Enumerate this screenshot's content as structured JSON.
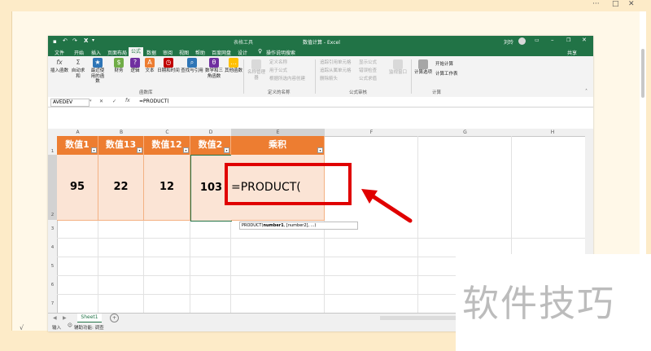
{
  "viewer": {
    "controls": [
      "···",
      "□",
      "✕"
    ],
    "tick": "√"
  },
  "window": {
    "tool_context": "表格工具",
    "title": "数值计算 - Excel",
    "user": "刘玲",
    "share": "共享",
    "qat_icons": [
      "save-icon",
      "undo-icon",
      "redo-icon",
      "excel-icon"
    ]
  },
  "ribbon_tabs": [
    "文件",
    "开始",
    "插入",
    "页面布局",
    "公式",
    "数据",
    "审阅",
    "视图",
    "帮助",
    "百度网盘",
    "设计"
  ],
  "active_tab": "公式",
  "tell_me": "操作说明搜索",
  "function_library": {
    "group_label": "函数库",
    "buttons": [
      {
        "label": "插入函数",
        "icon": "fx",
        "color": "#555"
      },
      {
        "label": "自动求和",
        "icon": "Σ",
        "color": "#555"
      },
      {
        "label": "最近使用的函数",
        "icon": "★",
        "color": "#2e75b6"
      },
      {
        "label": "财务",
        "icon": "$",
        "color": "#70ad47"
      },
      {
        "label": "逻辑",
        "icon": "?",
        "color": "#7030a0"
      },
      {
        "label": "文本",
        "icon": "A",
        "color": "#ed7d31"
      },
      {
        "label": "日期和时间",
        "icon": "◷",
        "color": "#c00000"
      },
      {
        "label": "查找与引用",
        "icon": "⌕",
        "color": "#2e75b6"
      },
      {
        "label": "数学和三角函数",
        "icon": "θ",
        "color": "#7030a0"
      },
      {
        "label": "其他函数",
        "icon": "…",
        "color": "#ffc000"
      }
    ]
  },
  "defined_names": {
    "group_label": "定义的名称",
    "manager": "名称管理器",
    "items": [
      "定义名称",
      "用于公式",
      "根据所选内容创建"
    ]
  },
  "formula_auditing": {
    "group_label": "公式审核",
    "items": [
      "追踪引用单元格",
      "追踪从属单元格",
      "删除箭头",
      "显示公式",
      "错误检查",
      "公式求值"
    ],
    "watch": "监视窗口"
  },
  "calculation": {
    "group_label": "计算",
    "options": "计算选项",
    "items": [
      "开始计算",
      "计算工作表"
    ]
  },
  "formula_bar": {
    "name_box": "AVEDEV",
    "cancel": "✕",
    "enter": "✓",
    "fx": "fx",
    "content": "=PRODUCT("
  },
  "columns": [
    "A",
    "B",
    "C",
    "D",
    "E",
    "F",
    "G",
    "H"
  ],
  "rows": [
    "1",
    "2",
    "3",
    "4",
    "5",
    "6",
    "7"
  ],
  "table": {
    "headers": [
      "数值1",
      "数值13",
      "数值12",
      "数值2",
      "乘积"
    ],
    "values": [
      "95",
      "22",
      "12",
      "103",
      "=PRODUCT("
    ]
  },
  "tooltip": {
    "function": "PRODUCT(",
    "arg1": "number1",
    "rest": ", [number2], ...)"
  },
  "sheet": {
    "tab": "Sheet1",
    "add": "+"
  },
  "status": {
    "mode": "输入",
    "accessibility": "辅助功能: 调查"
  },
  "annotation_color": "#e00000",
  "watermark": "软件技巧"
}
